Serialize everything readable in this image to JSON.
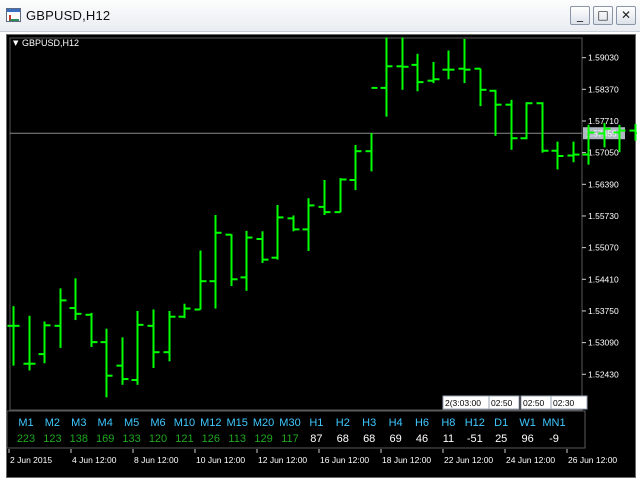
{
  "window": {
    "title": "GBPUSD,H12",
    "minimize_glyph": "_",
    "maximize_glyph": "□",
    "close_glyph": "✕",
    "icon": "chart-app-icon"
  },
  "chart": {
    "symbol_label": "GBPUSD,H12",
    "menu_glyph": "▼",
    "current_price": "1.57455",
    "colors": {
      "background": "#000000",
      "bars": "#00ff00",
      "axis_text": "#ffffff",
      "price_line": "#8a8a8a",
      "price_tag_bg": "#b0b8c4",
      "timeframe_label": "#3ec8ff",
      "positive_value": "#1fa81f",
      "neutral_value": "#ffffff"
    }
  },
  "timer_boxes": [
    "2(3:03:00",
    "02:50",
    "02:50",
    "02:30"
  ],
  "timeframes": [
    {
      "label": "M1",
      "value": "223"
    },
    {
      "label": "M2",
      "value": "123"
    },
    {
      "label": "M3",
      "value": "138"
    },
    {
      "label": "M4",
      "value": "169"
    },
    {
      "label": "M5",
      "value": "133"
    },
    {
      "label": "M6",
      "value": "120"
    },
    {
      "label": "M10",
      "value": "121"
    },
    {
      "label": "M12",
      "value": "126"
    },
    {
      "label": "M15",
      "value": "113"
    },
    {
      "label": "M20",
      "value": "129"
    },
    {
      "label": "M30",
      "value": "117"
    },
    {
      "label": "H1",
      "value": "87"
    },
    {
      "label": "H2",
      "value": "68"
    },
    {
      "label": "H3",
      "value": "68"
    },
    {
      "label": "H4",
      "value": "69"
    },
    {
      "label": "H6",
      "value": "46"
    },
    {
      "label": "H8",
      "value": "11"
    },
    {
      "label": "H12",
      "value": "-51"
    },
    {
      "label": "D1",
      "value": "25"
    },
    {
      "label": "W1",
      "value": "96"
    },
    {
      "label": "MN1",
      "value": "-9"
    }
  ],
  "chart_data": {
    "type": "ohlc",
    "title": "GBPUSD,H12",
    "ylim": [
      1.51685,
      1.5944
    ],
    "y_ticks": [
      "1.59030",
      "1.58370",
      "1.57710",
      "1.57050",
      "1.56390",
      "1.55730",
      "1.55070",
      "1.54410",
      "1.53750",
      "1.53090",
      "1.52430"
    ],
    "x_ticks": [
      "2 Jun 2015",
      "4 Jun 12:00",
      "8 Jun 12:00",
      "10 Jun 12:00",
      "12 Jun 12:00",
      "16 Jun 12:00",
      "18 Jun 12:00",
      "22 Jun 12:00",
      "24 Jun 12:00",
      "26 Jun 12:00"
    ],
    "bars": [
      {
        "o": 1.5344,
        "h": 1.5385,
        "l": 1.5261,
        "c": 1.5344
      },
      {
        "o": 1.5265,
        "h": 1.5365,
        "l": 1.5251,
        "c": 1.5265
      },
      {
        "o": 1.5285,
        "h": 1.5353,
        "l": 1.5266,
        "c": 1.5345
      },
      {
        "o": 1.5344,
        "h": 1.5422,
        "l": 1.5298,
        "c": 1.5397
      },
      {
        "o": 1.5381,
        "h": 1.5443,
        "l": 1.5356,
        "c": 1.5369
      },
      {
        "o": 1.5367,
        "h": 1.5371,
        "l": 1.53,
        "c": 1.531
      },
      {
        "o": 1.531,
        "h": 1.5338,
        "l": 1.5195,
        "c": 1.524
      },
      {
        "o": 1.5261,
        "h": 1.532,
        "l": 1.5221,
        "c": 1.5233
      },
      {
        "o": 1.5231,
        "h": 1.5375,
        "l": 1.5221,
        "c": 1.5346
      },
      {
        "o": 1.5344,
        "h": 1.5378,
        "l": 1.5256,
        "c": 1.5289
      },
      {
        "o": 1.5289,
        "h": 1.5375,
        "l": 1.527,
        "c": 1.5363
      },
      {
        "o": 1.5363,
        "h": 1.539,
        "l": 1.536,
        "c": 1.538
      },
      {
        "o": 1.5378,
        "h": 1.5501,
        "l": 1.5378,
        "c": 1.5437
      },
      {
        "o": 1.5437,
        "h": 1.5575,
        "l": 1.538,
        "c": 1.5538
      },
      {
        "o": 1.5534,
        "h": 1.5535,
        "l": 1.5427,
        "c": 1.5441
      },
      {
        "o": 1.5445,
        "h": 1.5542,
        "l": 1.5417,
        "c": 1.5528
      },
      {
        "o": 1.5525,
        "h": 1.5541,
        "l": 1.5475,
        "c": 1.5482
      },
      {
        "o": 1.5486,
        "h": 1.5596,
        "l": 1.5482,
        "c": 1.557
      },
      {
        "o": 1.5568,
        "h": 1.5574,
        "l": 1.5541,
        "c": 1.5545
      },
      {
        "o": 1.5545,
        "h": 1.561,
        "l": 1.55,
        "c": 1.5595
      },
      {
        "o": 1.5592,
        "h": 1.5648,
        "l": 1.5575,
        "c": 1.5581
      },
      {
        "o": 1.5581,
        "h": 1.5652,
        "l": 1.5581,
        "c": 1.5649
      },
      {
        "o": 1.5648,
        "h": 1.5721,
        "l": 1.5627,
        "c": 1.5708
      },
      {
        "o": 1.5708,
        "h": 1.5746,
        "l": 1.5666,
        "c": 1.584
      },
      {
        "o": 1.584,
        "h": 1.5945,
        "l": 1.578,
        "c": 1.5885
      },
      {
        "o": 1.5885,
        "h": 1.5945,
        "l": 1.5836,
        "c": 1.5884
      },
      {
        "o": 1.5888,
        "h": 1.5911,
        "l": 1.5833,
        "c": 1.5852
      },
      {
        "o": 1.5855,
        "h": 1.5894,
        "l": 1.585,
        "c": 1.5858
      },
      {
        "o": 1.5878,
        "h": 1.5918,
        "l": 1.5858,
        "c": 1.5878
      },
      {
        "o": 1.588,
        "h": 1.5942,
        "l": 1.585,
        "c": 1.5878
      },
      {
        "o": 1.588,
        "h": 1.588,
        "l": 1.5802,
        "c": 1.5836
      },
      {
        "o": 1.5834,
        "h": 1.5836,
        "l": 1.574,
        "c": 1.5805
      },
      {
        "o": 1.5805,
        "h": 1.5815,
        "l": 1.5711,
        "c": 1.5735
      },
      {
        "o": 1.5735,
        "h": 1.581,
        "l": 1.5733,
        "c": 1.5808
      },
      {
        "o": 1.5808,
        "h": 1.581,
        "l": 1.5705,
        "c": 1.5709
      },
      {
        "o": 1.5709,
        "h": 1.5728,
        "l": 1.567,
        "c": 1.5698
      },
      {
        "o": 1.5699,
        "h": 1.5728,
        "l": 1.5685,
        "c": 1.5701
      },
      {
        "o": 1.5701,
        "h": 1.5763,
        "l": 1.568,
        "c": 1.5747
      },
      {
        "o": 1.5745,
        "h": 1.5767,
        "l": 1.5716,
        "c": 1.5755
      },
      {
        "o": 1.5747,
        "h": 1.5763,
        "l": 1.5706,
        "c": 1.5751
      },
      {
        "o": 1.5751,
        "h": 1.5765,
        "l": 1.573,
        "c": 1.5746
      }
    ]
  }
}
